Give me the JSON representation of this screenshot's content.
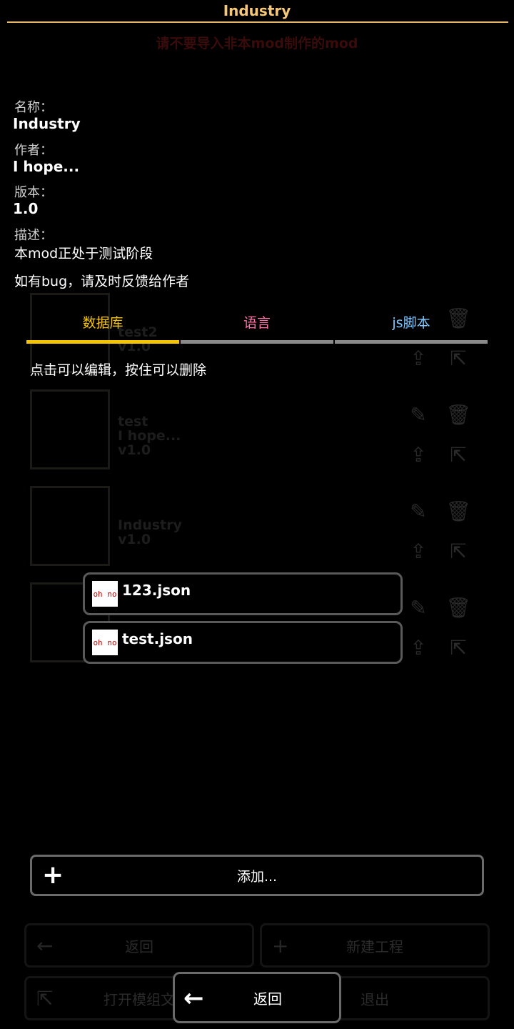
{
  "title": "Industry",
  "colors": {
    "title": "#f5c778",
    "tab_database": "#f5c400",
    "tab_language": "#ff6fa8",
    "tab_js": "#7fc8ff",
    "tab_inactive_bar": "#8a8a8a",
    "warning": "#3a0b0b"
  },
  "background": {
    "warning": "请不要导入非本mod制作的mod",
    "mods": [
      {
        "line1": "test2",
        "line2": "v1.0",
        "line3": ""
      },
      {
        "line1": "test",
        "line2": "I hope...",
        "line3": "v1.0"
      },
      {
        "line1": "Industry",
        "line2": "v1.0",
        "line3": ""
      },
      {
        "line1": "",
        "line2": "",
        "line3": ""
      }
    ],
    "buttons": {
      "back": "返回",
      "new_project": "新建工程",
      "open_mod_file": "打开模组文",
      "exit": "退出"
    },
    "icons": [
      "edit-icon",
      "trash-icon",
      "upload-icon",
      "export-icon"
    ]
  },
  "info": {
    "name_label": "名称：",
    "name": "Industry",
    "author_label": "作者：",
    "author": "I hope...",
    "version_label": "版本：",
    "version": "1.0",
    "desc_label": "描述：",
    "desc_line1": "本mod正处于测试阶段",
    "desc_line2": "如有bug，请及时反馈给作者"
  },
  "tabs": [
    {
      "label": "数据库",
      "active": true
    },
    {
      "label": "语言",
      "active": false
    },
    {
      "label": "js脚本",
      "active": false
    }
  ],
  "hint": "点击可以编辑，按住可以删除",
  "files": [
    {
      "name": "123.json",
      "icon_text": "oh no"
    },
    {
      "name": "test.json",
      "icon_text": "oh no"
    }
  ],
  "add_button": "添加...",
  "back_button": "返回"
}
